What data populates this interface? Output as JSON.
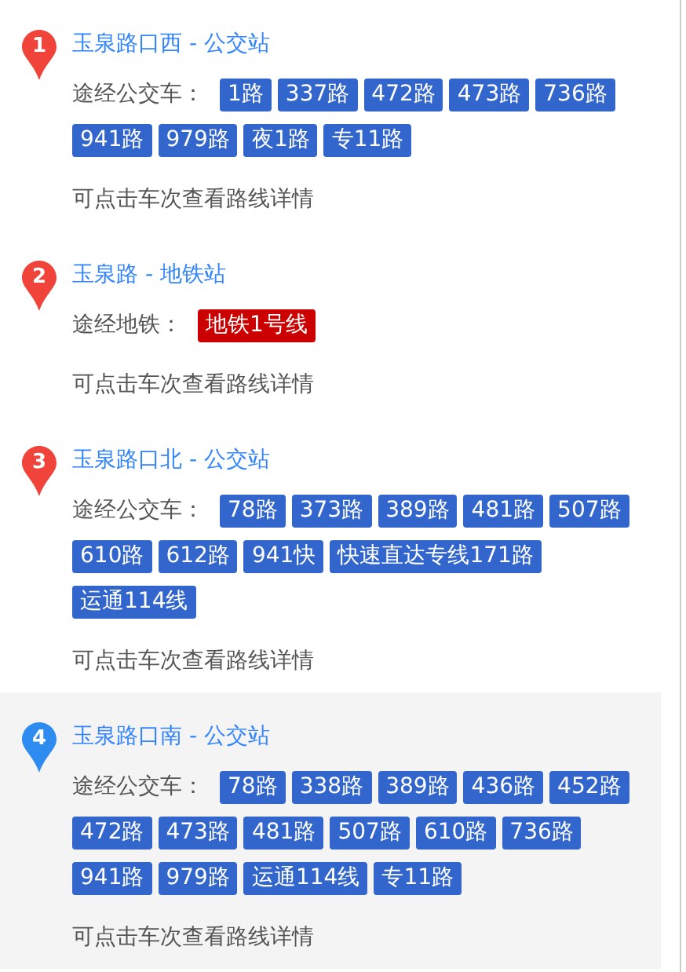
{
  "stations": [
    {
      "number": "1",
      "name": "玉泉路口西 - 公交站",
      "selected": false,
      "label": "途经公交车：",
      "note": "可点击车次查看路线详情",
      "lines": [
        {
          "name": "1路",
          "color": "#3366cc"
        },
        {
          "name": "337路",
          "color": "#3366cc"
        },
        {
          "name": "472路",
          "color": "#3366cc"
        },
        {
          "name": "473路",
          "color": "#3366cc"
        },
        {
          "name": "736路",
          "color": "#3366cc"
        },
        {
          "name": "941路",
          "color": "#3366cc"
        },
        {
          "name": "979路",
          "color": "#3366cc"
        },
        {
          "name": "夜1路",
          "color": "#3366cc"
        },
        {
          "name": "专11路",
          "color": "#3366cc"
        }
      ]
    },
    {
      "number": "2",
      "name": "玉泉路 - 地铁站",
      "selected": false,
      "label": "途经地铁：",
      "note": "可点击车次查看路线详情",
      "lines": [
        {
          "name": "地铁1号线",
          "color": "#cc0000"
        }
      ]
    },
    {
      "number": "3",
      "name": "玉泉路口北 - 公交站",
      "selected": false,
      "label": "途经公交车：",
      "note": "可点击车次查看路线详情",
      "lines": [
        {
          "name": "78路",
          "color": "#3366cc"
        },
        {
          "name": "373路",
          "color": "#3366cc"
        },
        {
          "name": "389路",
          "color": "#3366cc"
        },
        {
          "name": "481路",
          "color": "#3366cc"
        },
        {
          "name": "507路",
          "color": "#3366cc"
        },
        {
          "name": "610路",
          "color": "#3366cc"
        },
        {
          "name": "612路",
          "color": "#3366cc"
        },
        {
          "name": "941快",
          "color": "#3366cc"
        },
        {
          "name": "快速直达专线171路",
          "color": "#3366cc"
        },
        {
          "name": "运通114线",
          "color": "#3366cc"
        }
      ]
    },
    {
      "number": "4",
      "name": "玉泉路口南 - 公交站",
      "selected": true,
      "label": "途经公交车：",
      "note": "可点击车次查看路线详情",
      "lines": [
        {
          "name": "78路",
          "color": "#3366cc"
        },
        {
          "name": "338路",
          "color": "#3366cc"
        },
        {
          "name": "389路",
          "color": "#3366cc"
        },
        {
          "name": "436路",
          "color": "#3366cc"
        },
        {
          "name": "452路",
          "color": "#3366cc"
        },
        {
          "name": "472路",
          "color": "#3366cc"
        },
        {
          "name": "473路",
          "color": "#3366cc"
        },
        {
          "name": "481路",
          "color": "#3366cc"
        },
        {
          "name": "507路",
          "color": "#3366cc"
        },
        {
          "name": "610路",
          "color": "#3366cc"
        },
        {
          "name": "736路",
          "color": "#3366cc"
        },
        {
          "name": "941路",
          "color": "#3366cc"
        },
        {
          "name": "979路",
          "color": "#3366cc"
        },
        {
          "name": "运通114线",
          "color": "#3366cc"
        },
        {
          "name": "专11路",
          "color": "#3366cc"
        }
      ]
    }
  ]
}
